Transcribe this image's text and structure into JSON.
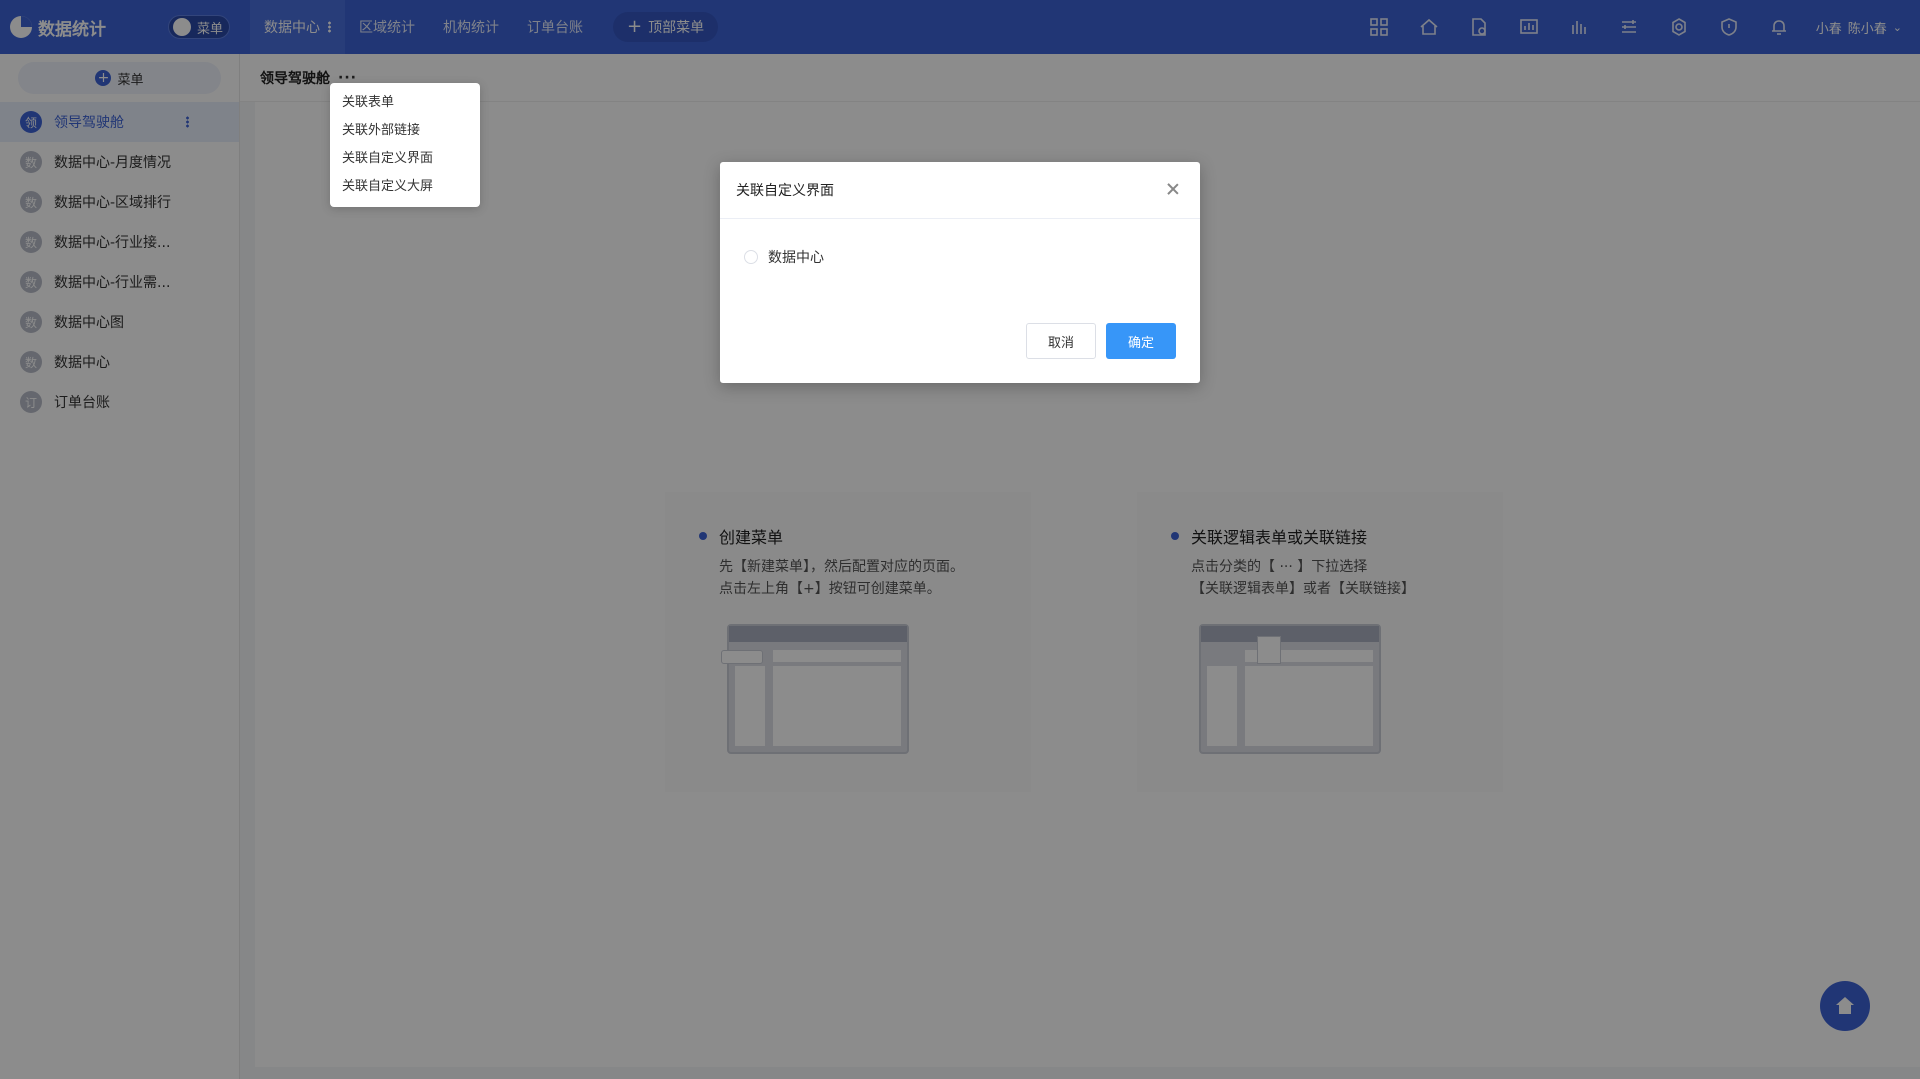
{
  "app": {
    "title": "数据统计",
    "menu_toggle_label": "菜单"
  },
  "top_nav": [
    {
      "label": "数据中心",
      "active": true
    },
    {
      "label": "区域统计"
    },
    {
      "label": "机构统计"
    },
    {
      "label": "订单台账"
    }
  ],
  "top_add_label": "顶部菜单",
  "top_icons": [
    "grid-icon",
    "home-icon",
    "document-gear-icon",
    "chart-icon",
    "waves-icon",
    "layers-icon",
    "settings-icon",
    "shield-icon",
    "bell-icon"
  ],
  "user": {
    "short_name": "小春",
    "full_name": "陈小春"
  },
  "sidebar": {
    "add_label": "菜单",
    "items": [
      {
        "badge": "领",
        "label": "领导驾驶舱",
        "active": true
      },
      {
        "badge": "数",
        "label": "数据中心-月度情况"
      },
      {
        "badge": "数",
        "label": "数据中心-区域排行"
      },
      {
        "badge": "数",
        "label": "数据中心-行业接..."
      },
      {
        "badge": "数",
        "label": "数据中心-行业需..."
      },
      {
        "badge": "数",
        "label": "数据中心图"
      },
      {
        "badge": "数",
        "label": "数据中心"
      },
      {
        "badge": "订",
        "label": "订单台账"
      }
    ]
  },
  "breadcrumb": {
    "title": "领导驾驶舱",
    "more": "···"
  },
  "dropdown": {
    "items": [
      "关联表单",
      "关联外部链接",
      "关联自定义界面",
      "关联自定义大屏"
    ]
  },
  "guides": [
    {
      "title": "创建菜单",
      "line1": "先【新建菜单】，然后配置对应的页面。",
      "line2": "点击左上角【+】按钮可创建菜单。"
    },
    {
      "title": "关联逻辑表单或关联链接",
      "line1": "点击分类的【 ··· 】下拉选择",
      "line2": "【关联逻辑表单】或者【关联链接】"
    }
  ],
  "dialog": {
    "title": "关联自定义界面",
    "option_label": "数据中心",
    "cancel_label": "取消",
    "ok_label": "确定"
  },
  "colors": {
    "primary": "#3c63d6",
    "button_primary": "#3796f8"
  }
}
